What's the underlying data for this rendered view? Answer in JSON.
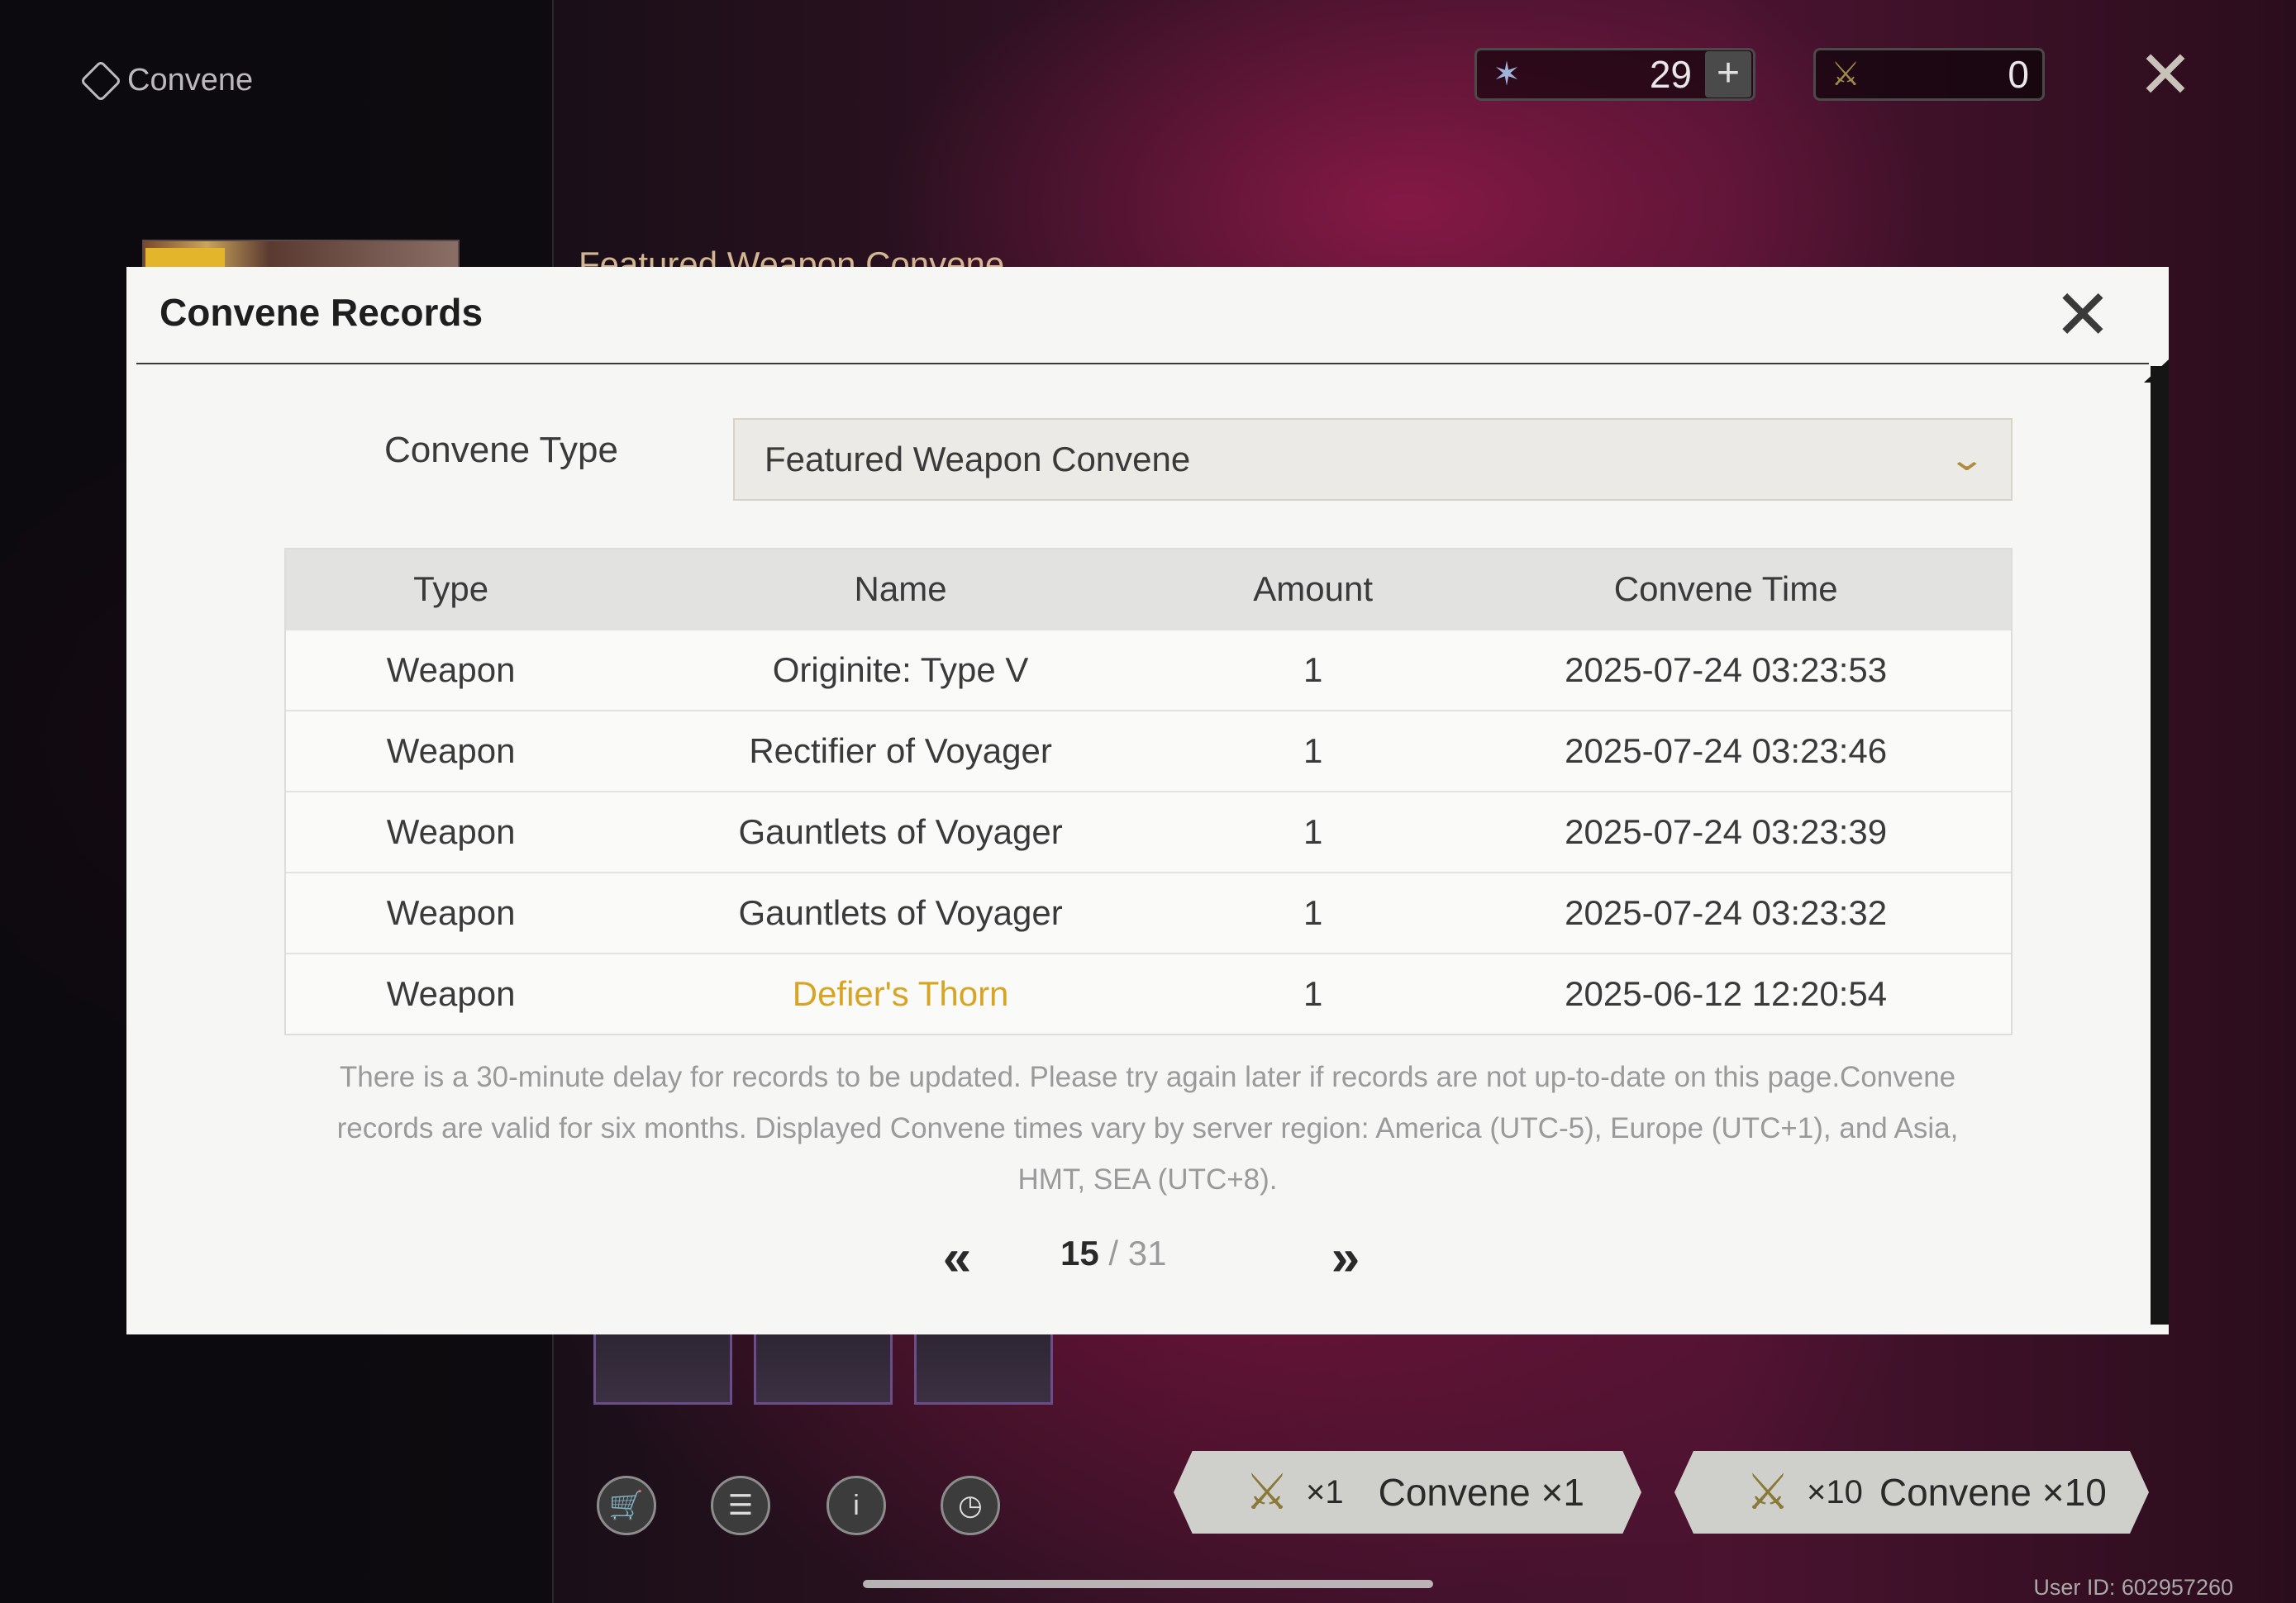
{
  "app": {
    "title": "Convene"
  },
  "background": {
    "banner_title": "Featured Weapon Convene",
    "currencies": [
      {
        "icon": "radiant-tide-icon",
        "value": "29"
      },
      {
        "icon": "forging-tide-icon",
        "value": "0"
      }
    ],
    "pull_buttons": [
      {
        "cost": "×1",
        "label": "Convene ×1"
      },
      {
        "cost": "×10",
        "label": "Convene ×10"
      }
    ],
    "user_id": "User ID: 602957260"
  },
  "modal": {
    "title": "Convene Records",
    "convene_type_label": "Convene Type",
    "convene_type_value": "Featured Weapon Convene",
    "table": {
      "headers": [
        "Type",
        "Name",
        "Amount",
        "Convene Time"
      ],
      "rows": [
        {
          "type": "Weapon",
          "name": "Originite: Type V",
          "amount": "1",
          "time": "2025-07-24 03:23:53"
        },
        {
          "type": "Weapon",
          "name": "Rectifier of Voyager",
          "amount": "1",
          "time": "2025-07-24 03:23:46"
        },
        {
          "type": "Weapon",
          "name": "Gauntlets of Voyager",
          "amount": "1",
          "time": "2025-07-24 03:23:39"
        },
        {
          "type": "Weapon",
          "name": "Gauntlets of Voyager",
          "amount": "1",
          "time": "2025-07-24 03:23:32"
        },
        {
          "type": "Weapon",
          "name": "Defier's Thorn",
          "amount": "1",
          "time": "2025-06-12 12:20:54"
        }
      ]
    },
    "note": "There is a 30-minute delay for records to be updated. Please try again later if records are not up-to-date on this page.Convene records are valid for six months. Displayed Convene times vary by server region: America (UTC-5), Europe (UTC+1), and Asia, HMT, SEA (UTC+8).",
    "pagination": {
      "current": "15",
      "separator": "/",
      "total": "31"
    }
  },
  "colors": {
    "highlight_gold": "#d8a424",
    "accent_chevron": "#b08d3c"
  }
}
